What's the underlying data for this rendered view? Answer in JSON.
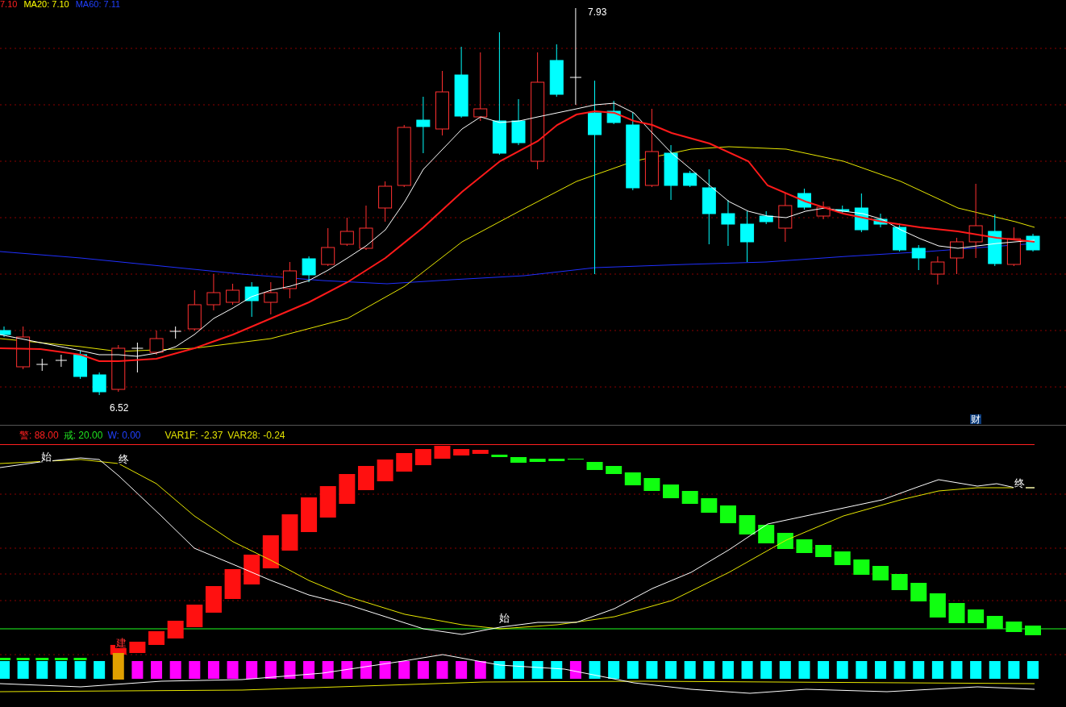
{
  "ma_legend": [
    {
      "text": "7.10",
      "color": "#ff2020"
    },
    {
      "text": "MA20: 7.10",
      "color": "#ffff00"
    },
    {
      "text": "MA60: 7.11",
      "color": "#2040ff"
    }
  ],
  "price_labels": [
    {
      "text": "7.93"
    },
    {
      "text": "6.52"
    }
  ],
  "finance_marker": "财",
  "indicator_legend": [
    {
      "text": "警: 88.00",
      "color": "#ff2020"
    },
    {
      "text": "戒: 20.00",
      "color": "#20e020"
    },
    {
      "text": "W: 0.00",
      "color": "#2040ff"
    },
    {
      "text": "VAR1F: -2.37",
      "color": "#e0e000"
    },
    {
      "text": "VAR28: -0.24",
      "color": "#e0e000"
    }
  ],
  "signal_markers": [
    {
      "text": "始"
    },
    {
      "text": "终"
    },
    {
      "text": "始"
    },
    {
      "text": "终"
    },
    {
      "text": "建"
    }
  ]
}
